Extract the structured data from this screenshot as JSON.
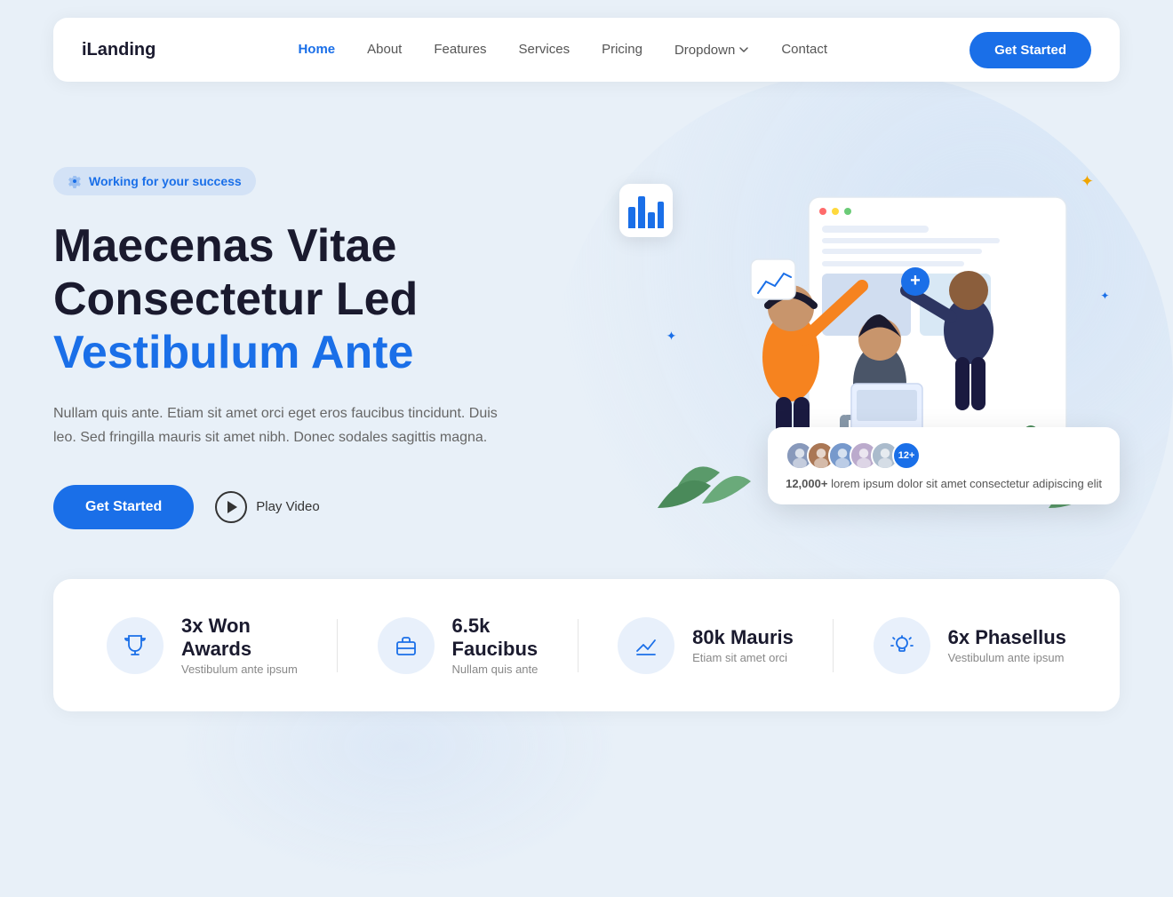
{
  "brand": {
    "logo": "iLanding"
  },
  "nav": {
    "links": [
      {
        "label": "Home",
        "active": true
      },
      {
        "label": "About",
        "active": false
      },
      {
        "label": "Features",
        "active": false
      },
      {
        "label": "Services",
        "active": false
      },
      {
        "label": "Pricing",
        "active": false
      },
      {
        "label": "Dropdown",
        "active": false
      },
      {
        "label": "Contact",
        "active": false
      }
    ],
    "cta": "Get Started"
  },
  "hero": {
    "badge": "Working for your success",
    "title_line1": "Maecenas Vitae",
    "title_line2": "Consectetur Led",
    "title_line3": "Vestibulum Ante",
    "description": "Nullam quis ante. Etiam sit amet orci eget eros faucibus tincidunt. Duis leo. Sed fringilla mauris sit amet nibh. Donec sodales sagittis magna.",
    "cta_primary": "Get Started",
    "cta_video": "Play Video",
    "stats_card": {
      "count": "12,000+",
      "text": "lorem ipsum dolor sit amet consectetur adipiscing elit",
      "extra_count": "12+"
    }
  },
  "stats": [
    {
      "icon": "trophy",
      "number": "3x Won",
      "label_bold": "Awards",
      "label_sub": "Vestibulum ante ipsum"
    },
    {
      "icon": "briefcase",
      "number": "6.5k",
      "label_bold": "Faucibus",
      "label_sub": "Nullam quis ante"
    },
    {
      "icon": "chart",
      "number": "80k Mauris",
      "label_bold": "",
      "label_sub": "Etiam sit amet orci"
    },
    {
      "icon": "bulb",
      "number": "6x Phasellus",
      "label_bold": "",
      "label_sub": "Vestibulum ante ipsum"
    }
  ],
  "sparkles": [
    "✦",
    "✦",
    "✦",
    "✦",
    "✦"
  ],
  "colors": {
    "primary": "#1a6fe8",
    "dark": "#1a1a2e",
    "gray": "#888888"
  }
}
